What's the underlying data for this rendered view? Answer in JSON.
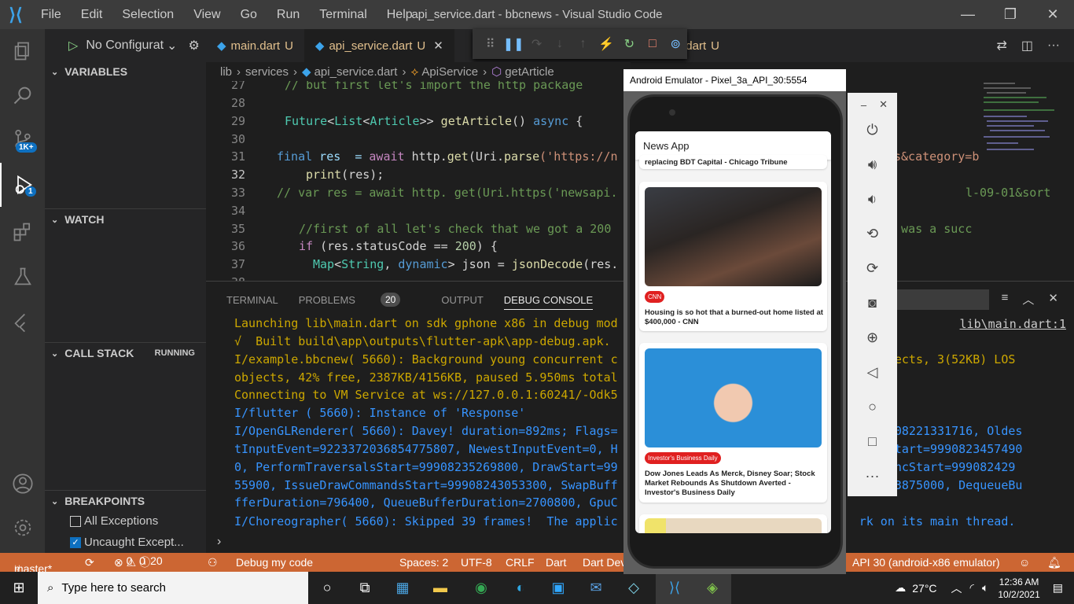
{
  "titlebar": {
    "menu": [
      "File",
      "Edit",
      "Selection",
      "View",
      "Go",
      "Run",
      "Terminal",
      "Help"
    ],
    "title": "api_service.dart - bbcnews - Visual Studio Code"
  },
  "activity": {
    "scm_badge": "1K+",
    "debug_badge": "1"
  },
  "sidebar": {
    "config": "No Configurat",
    "sections": {
      "variables": "VARIABLES",
      "watch": "WATCH",
      "callstack": "CALL STACK",
      "callstack_state": "RUNNING",
      "breakpoints": "BREAKPOINTS"
    },
    "breakpoints": [
      {
        "label": "All Exceptions",
        "checked": false
      },
      {
        "label": "Uncaught Except...",
        "checked": true
      }
    ]
  },
  "tabs": [
    {
      "label": "main.dart",
      "mod": "U"
    },
    {
      "label": "api_service.dart",
      "mod": "U"
    },
    {
      "label": "e.dart",
      "mod": "U"
    }
  ],
  "breadcrumb": [
    "lib",
    "services",
    "api_service.dart",
    "ApiService",
    "getArticle"
  ],
  "code": {
    "line_numbers": [
      "27",
      "28",
      "29",
      "30",
      "31",
      "32",
      "33",
      "34",
      "35",
      "36",
      "37",
      "38"
    ],
    "current_line": "32",
    "l27": "// but first let's import the http package",
    "l29a": "Future",
    "l29b": "<",
    "l29c": "List",
    "l29d": "<",
    "l29e": "Article",
    ">>": ">>",
    "l29f": " getArticle",
    "l29g": "() ",
    "l29h": "async",
    "l29i": " {",
    "l31a": "final",
    "l31b": " res  = ",
    "l31c": "await",
    "l31d": " http.",
    "l31e": "get",
    "l31f": "(Uri.",
    "l31g": "parse",
    "l31h": "('https://n",
    "l31i": "s&category=b",
    "l32a": "print",
    "l32b": "(res);",
    "l33a": "// var res = await http. get(Uri.https('newsapi.",
    "l33b": "l-09-01&sort",
    "l35a": "//first of all let's check that we got a 200",
    "l35b": "t was a succ",
    "l36a": "if",
    "l36b": " (res.statusCode == ",
    "l36c": "200",
    "l36d": ") {",
    "l37a": "Map",
    "l37b": "<",
    "l37c": "String",
    ", ": ", ",
    "l37d": "dynamic",
    "l37e": "> json = ",
    "l37f": "jsonDecode",
    "l37g": "(res."
  },
  "panel": {
    "tabs": [
      "TERMINAL",
      "PROBLEMS",
      "OUTPUT",
      "DEBUG CONSOLE"
    ],
    "problems_count": "20",
    "link": "lib\\main.dart:1",
    "lines": [
      "Launching lib\\main.dart on sdk gphone x86 in debug mod",
      "√  Built build\\app\\outputs\\flutter-apk\\app-debug.apk.",
      "I/example.bbcnew( 5660): Background young concurrent c                                  e objects, 3(52KB) LOS",
      "objects, 42% free, 2387KB/4156KB, paused 5.950ms total",
      "Connecting to VM Service at ws://127.0.0.1:60241/-Odk5",
      "I/flutter ( 5660): Instance of 'Response'",
      "I/OpenGLRenderer( 5660): Davey! duration=892ms; Flags=                                  c=99908221331716, Oldes",
      "tInputEvent=9223372036854775807, NewestInputEvent=0, H                                  tionStart=9990823457490",
      "0, PerformTraversalsStart=99908235269800, DrawStart=99                                  0, SyncStart=999082429",
      "55900, IssueDrawCommandsStart=99908243053300, SwapBuff                                  908903875000, DequeueBu",
      "fferDuration=796400, QueueBufferDuration=2700800, GpuC",
      "I/Choreographer( 5660): Skipped 39 frames!  The applic                                  rk on its main thread."
    ]
  },
  "status": {
    "branch": "master*",
    "errors": "0",
    "warnings": "0",
    "info": "20",
    "debug": "Debug my code",
    "spaces": "Spaces: 2",
    "encoding": "UTF-8",
    "eol": "CRLF",
    "lang": "Dart",
    "devtools": "Dart Dev",
    "device": "API 30 (android-x86 emulator)"
  },
  "taskbar": {
    "search": "Type here to search",
    "temp": "27°C",
    "time": "12:36 AM",
    "date": "10/2/2021"
  },
  "emulator": {
    "title": "Android Emulator - Pixel_3a_API_30:5554",
    "app_title": "News App",
    "cards": [
      {
        "headline_tail": "replacing BDT Capital - Chicago Tribune"
      },
      {
        "source": "CNN",
        "headline": "Housing is so hot that a burned-out home listed at $400,000 - CNN"
      },
      {
        "source": "Investor's Business Daily",
        "headline": "Dow Jones Leads As Merck, Disney Soar; Stock Market Rebounds As Shutdown Averted - Investor's Business Daily"
      }
    ]
  }
}
